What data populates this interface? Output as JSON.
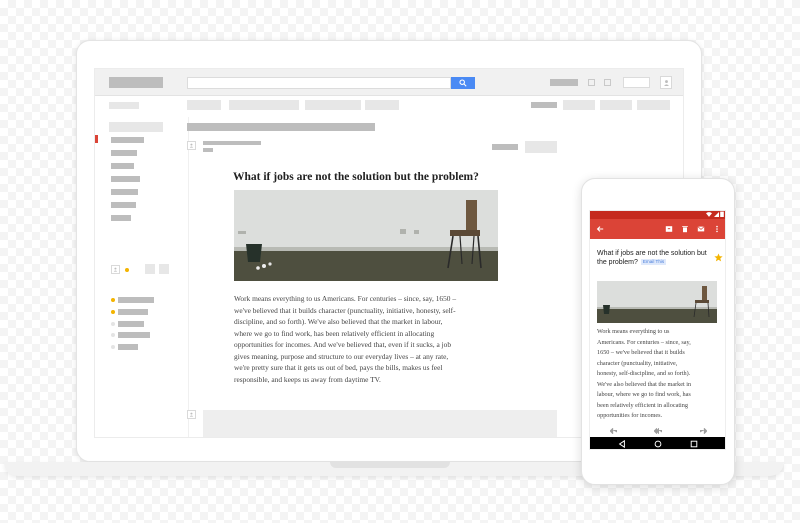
{
  "email": {
    "subject": "What if jobs are not the solution but the problem?",
    "body": "Work means everything to us Americans. For centuries – since, say, 1650 –\nwe've believed that it builds character (punctuality, initiative, honesty, self-\ndiscipline, and so forth). We've also believed that the market in labour,\nwhere we go to find work, has been relatively efficient in allocating\nopportunities for incomes. And we've believed that, even if it sucks, a job\ngives meaning, purpose and structure to our everyday lives – at any rate,\nwe're pretty sure that it gets us out of bed, pays the bills, makes us feel\nresponsible, and keeps us away from daytime TV."
  },
  "phone": {
    "subject": "What if jobs are not the solution but the problem?",
    "tag": "Email This",
    "body": "Work means everything to us\nAmericans. For centuries – since, say,\n1650 – we've believed that it builds\ncharacter (punctuality, initiative,\nhonesty, self-discipline, and so forth).\nWe've also believed that the market in\nlabour, where we go to find work, has\nbeen relatively efficient in allocating\nopportunities for incomes."
  },
  "icons": {
    "search": "search-icon",
    "account": "account-icon",
    "back": "arrow-back-icon",
    "archive": "archive-icon",
    "delete": "delete-icon",
    "mail": "mail-icon",
    "more": "more-vert-icon",
    "star": "star-icon",
    "reply": "reply-icon",
    "reply_all": "reply-all-icon",
    "forward": "forward-icon"
  },
  "colors": {
    "search_button": "#4a8af4",
    "appbar": "#db4437",
    "statusbar": "#c52b1f",
    "star": "#f4b400",
    "tag_bg": "#dfe9fb",
    "tag_text": "#4a7fdb",
    "inbox_marker": "#db4437"
  }
}
